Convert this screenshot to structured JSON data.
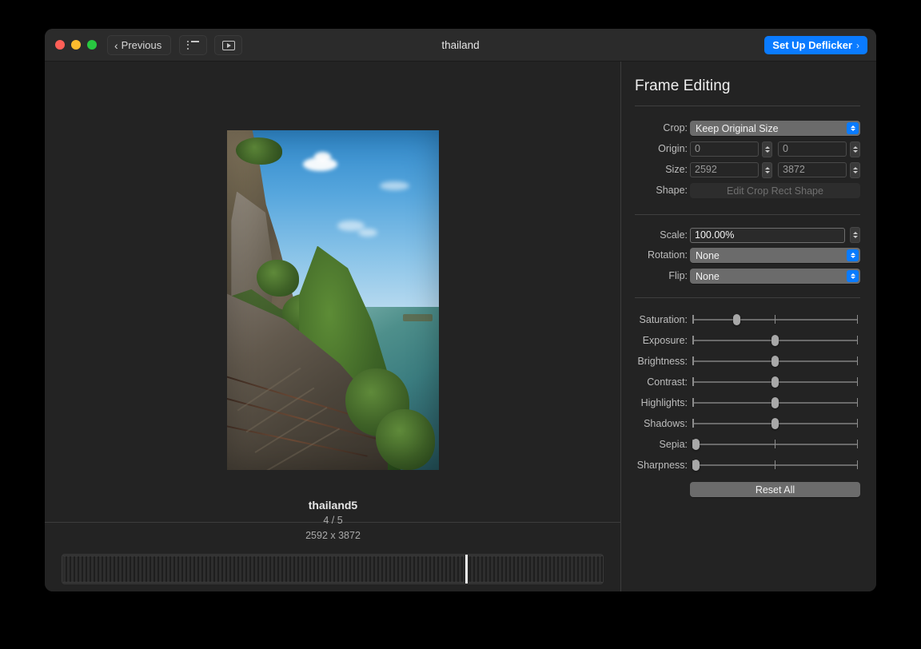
{
  "window": {
    "title": "thailand",
    "traffic_lights": [
      "close",
      "minimize",
      "zoom"
    ]
  },
  "toolbar": {
    "previous_label": "Previous",
    "previous_chevron": "‹",
    "list_icon": "list-icon",
    "play_icon": "play-box-icon",
    "deflicker_label": "Set Up Deflicker",
    "deflicker_chevron": "›",
    "accent_color": "#0a7bff"
  },
  "preview": {
    "file_name": "thailand5",
    "index": "4 / 5",
    "dimensions": "2592 x 3872"
  },
  "scrubber": {
    "playhead_percent": 74.6
  },
  "panel": {
    "title": "Frame Editing",
    "crop": {
      "label": "Crop:",
      "value": "Keep Original Size",
      "options": [
        "Keep Original Size"
      ]
    },
    "origin": {
      "label": "Origin:",
      "x": "0",
      "y": "0",
      "enabled": false
    },
    "size": {
      "label": "Size:",
      "width": "2592",
      "height": "3872",
      "enabled": false
    },
    "shape": {
      "label": "Shape:",
      "button_label": "Edit Crop Rect Shape",
      "enabled": false
    },
    "scale": {
      "label": "Scale:",
      "value": "100.00%",
      "enabled": true
    },
    "rotation": {
      "label": "Rotation:",
      "value": "None",
      "options": [
        "None"
      ]
    },
    "flip": {
      "label": "Flip:",
      "value": "None",
      "options": [
        "None"
      ]
    },
    "sliders": [
      {
        "label": "Saturation:",
        "percent": 26
      },
      {
        "label": "Exposure:",
        "percent": 50
      },
      {
        "label": "Brightness:",
        "percent": 50
      },
      {
        "label": "Contrast:",
        "percent": 50
      },
      {
        "label": "Highlights:",
        "percent": 50
      },
      {
        "label": "Shadows:",
        "percent": 50
      },
      {
        "label": "Sepia:",
        "percent": 0
      },
      {
        "label": "Sharpness:",
        "percent": 0
      }
    ],
    "reset_label": "Reset All"
  }
}
